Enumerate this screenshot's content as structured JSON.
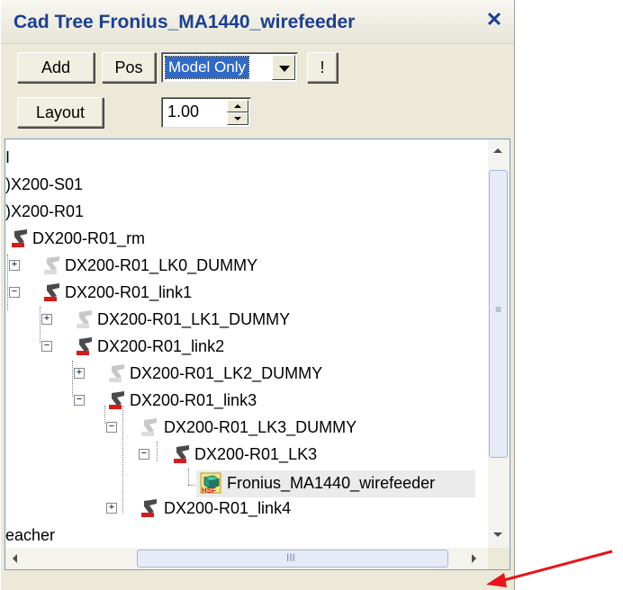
{
  "window": {
    "title": "Cad Tree Fronius_MA1440_wirefeeder",
    "close_glyph": "✕"
  },
  "toolbar": {
    "add_label": "Add",
    "pos_label": "Pos",
    "mode_selected": "Model Only",
    "exclaim_label": "!",
    "layout_label": "Layout",
    "scale_value": "1.00"
  },
  "tree": {
    "items": [
      {
        "label": "I"
      },
      {
        "label": ")X200-S01"
      },
      {
        "label": ")X200-R01"
      },
      {
        "label": "DX200-R01_rm",
        "icon": "robot-icon"
      },
      {
        "label": "DX200-R01_LK0_DUMMY",
        "icon": "robot-gray-icon",
        "expander": "+"
      },
      {
        "label": "DX200-R01_link1",
        "icon": "robot-icon",
        "expander": "-"
      },
      {
        "label": "DX200-R01_LK1_DUMMY",
        "icon": "robot-gray-icon",
        "expander": "+"
      },
      {
        "label": "DX200-R01_link2",
        "icon": "robot-icon",
        "expander": "-"
      },
      {
        "label": "DX200-R01_LK2_DUMMY",
        "icon": "robot-gray-icon",
        "expander": "+"
      },
      {
        "label": "DX200-R01_link3",
        "icon": "robot-icon",
        "expander": "-"
      },
      {
        "label": "DX200-R01_LK3_DUMMY",
        "icon": "robot-gray-icon",
        "expander": "-"
      },
      {
        "label": "DX200-R01_LK3",
        "icon": "robot-icon",
        "expander": "-"
      },
      {
        "label": "Fronius_MA1440_wirefeeder",
        "icon": "hsf-model-icon",
        "icon_text": "HSF",
        "selected": true
      },
      {
        "label": "DX200-R01_link4",
        "icon": "robot-icon",
        "expander": "+"
      },
      {
        "label": "eacher"
      }
    ]
  },
  "scrollbar": {
    "h_grip": "III",
    "v_grip": "≡"
  },
  "colors": {
    "title_text": "#1c3f8f",
    "selection": "#316ac5",
    "arrow": "#e8141b"
  }
}
